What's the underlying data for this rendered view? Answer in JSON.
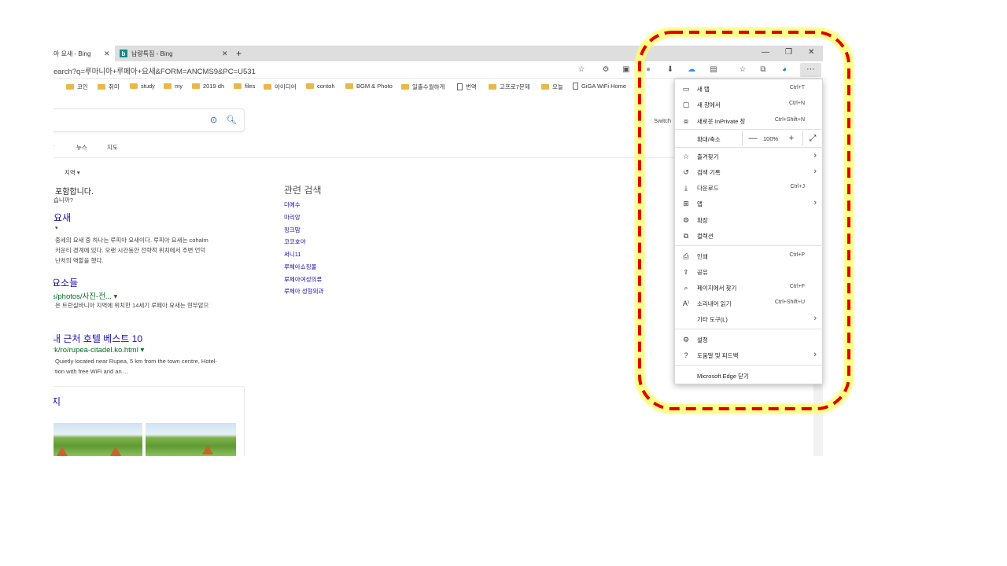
{
  "tabs": [
    {
      "title": "아 요새 - Bing",
      "close": "✕"
    },
    {
      "title": "납량특집 - Bing",
      "close": "✕"
    }
  ],
  "new_tab_label": "+",
  "window_controls": {
    "minimize": "—",
    "restore": "❐",
    "close": "✕"
  },
  "address_bar": {
    "url": "earch?q=루마니아+루페아+요새&FORM=ANCMS9&PC=U531"
  },
  "bookmarks": [
    {
      "label": "코인",
      "icon": "folder-icon"
    },
    {
      "label": "취미",
      "icon": "folder-icon"
    },
    {
      "label": "study",
      "icon": "folder-icon"
    },
    {
      "label": "my",
      "icon": "folder-icon"
    },
    {
      "label": "2019 dh",
      "icon": "folder-icon"
    },
    {
      "label": "files",
      "icon": "folder-icon"
    },
    {
      "label": "아이디어",
      "icon": "folder-icon"
    },
    {
      "label": "contoh",
      "icon": "folder-icon"
    },
    {
      "label": "BGM & Photo",
      "icon": "folder-icon"
    },
    {
      "label": "일출수월하게",
      "icon": "folder-icon"
    },
    {
      "label": "번역",
      "icon": "doc-icon"
    },
    {
      "label": "고프로7문제",
      "icon": "folder-icon"
    },
    {
      "label": "오늘",
      "icon": "folder-icon"
    },
    {
      "label": "GiGA WiFi Home",
      "icon": "doc-icon"
    }
  ],
  "page": {
    "nav": {
      "item1": "상",
      "news": "뉴스",
      "maps": "지도",
      "region": "지역 ▾"
    },
    "switch_label": "Switch",
    "result_intro": "포함합니다.",
    "result_intro2": "습니까?",
    "r1_title": "요새",
    "r1_url": "▾",
    "r1_desc1": "중세의 요새 중 하나는 루피아 요새이다. 루피아 요새는 cohalm",
    "r1_desc2": "카운티 경계에 있다. 오랜 시간동안 전략적 위치에서 주변 언덕",
    "r1_desc3": "난처의 역할을 했다.",
    "r2_title": "요소들",
    "r2_url": "s/photos/사진-전... ▾",
    "r2_desc1": "은 트란실바니아 지역에 위치한 14세기 루페아 요새는 현무암으",
    "r3_title": "내 근처 호텔 베스트 10",
    "r3_url": "rk/ro/rupea-citadel.ko.html ▾",
    "r3_desc1": "Quietly located near Rupea, 5 km from the town centre, Hotel-",
    "r3_desc2": "tion with free WiFi and an ...",
    "img_card_title": "지",
    "related_title": "관련 검색",
    "related": [
      "더예수",
      "마리앙",
      "핑크맘",
      "코코호야",
      "써니11",
      "루체아쇼핑몰",
      "루체아여성의류",
      "루체아 성형외과"
    ]
  },
  "menu": {
    "items": [
      {
        "icon": "new-tab-icon",
        "label": "새 탭",
        "shortcut": "Ctrl+T"
      },
      {
        "icon": "new-window-icon",
        "label": "새 창에서",
        "shortcut": "Ctrl+N"
      },
      {
        "icon": "inprivate-icon",
        "label": "새로운 InPrivate 창",
        "shortcut": "Ctrl+Shift+N"
      }
    ],
    "zoom": {
      "label": "확대/축소",
      "minus": "—",
      "value": "100%",
      "plus": "+",
      "fullscreen": "⤢"
    },
    "items2": [
      {
        "label": "즐겨찾기",
        "arrow": "›"
      },
      {
        "label": "검색 기록",
        "arrow": "›"
      },
      {
        "label": "다운로드",
        "shortcut": "Ctrl+J"
      },
      {
        "label": "앱",
        "arrow": "›"
      },
      {
        "label": "확장"
      },
      {
        "label": "컬렉션"
      }
    ],
    "items3": [
      {
        "label": "인쇄",
        "shortcut": "Ctrl+P"
      },
      {
        "label": "공유"
      },
      {
        "label": "페이지에서 찾기",
        "shortcut": "Ctrl+F"
      },
      {
        "label": "소리내어 읽기",
        "shortcut": "Ctrl+Shift+U"
      },
      {
        "label": "기타 도구(L)",
        "arrow": "›"
      }
    ],
    "items4": [
      {
        "label": "설정"
      },
      {
        "label": "도움말 및 피드백",
        "arrow": "›"
      }
    ],
    "close_edge": "Microsoft Edge 닫기"
  },
  "annotation": {
    "color": "#e00000",
    "glow": "#ffff66"
  }
}
